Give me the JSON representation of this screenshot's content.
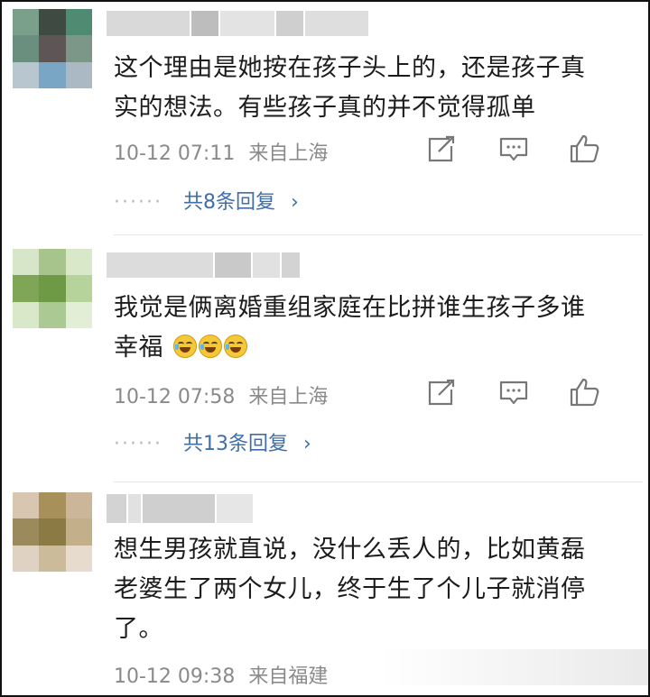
{
  "comments": [
    {
      "text_lines": [
        "这个理由是她按在孩子头上的，还是孩子真",
        "实的想法。有些孩子真的并不觉得孤单"
      ],
      "date": "10-12 07:11",
      "location": "来自上海",
      "replies": "共8条回复",
      "avatar_colors": [
        "#7aa08c",
        "#3f4a42",
        "#4f8a72",
        "#6b8f7e",
        "#5e5656",
        "#7c9787",
        "#b7c6cf",
        "#7aa6c6",
        "#aab9c3"
      ],
      "name_blur_colors": [
        "#d9d9d9",
        "#bdbdbd",
        "#e3e3e3",
        "#cfcfcf",
        "#dedede"
      ]
    },
    {
      "text_lines": [
        "我觉是俩离婚重组家庭在比拼谁生孩子多谁",
        "幸福"
      ],
      "emoji_count": 3,
      "date": "10-12 07:58",
      "location": "来自上海",
      "replies": "共13条回复",
      "avatar_colors": [
        "#d7e6c8",
        "#a6c48c",
        "#d9e8c9",
        "#7ea656",
        "#6f9a45",
        "#b7d39c",
        "#d9e8c9",
        "#aac993",
        "#e3eed7"
      ],
      "name_blur_colors": [
        "#dcdcdc",
        "#c9c9c9",
        "#e1e1e1",
        "#d3d3d3"
      ]
    },
    {
      "text_lines": [
        "想生男孩就直说，没什么丢人的，比如黄磊",
        "老婆生了两个女儿，终于生了个儿子就消停",
        "了。"
      ],
      "date": "10-12 09:38",
      "location": "来自福建",
      "avatar_colors": [
        "#d8c6b0",
        "#a8905b",
        "#cbb69a",
        "#9a8a5c",
        "#8b7a44",
        "#c3b08a",
        "#e0d2c2",
        "#cbbb9b",
        "#e6dbcd"
      ],
      "name_blur_colors": [
        "#d3d3d3",
        "#e1e1e1",
        "#cfcfcf",
        "#e6e6e6"
      ]
    }
  ],
  "icons": [
    "share-icon",
    "comment-icon",
    "like-icon"
  ]
}
